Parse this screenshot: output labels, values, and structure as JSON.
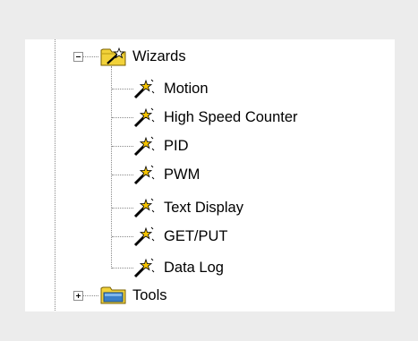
{
  "tree": {
    "wizards": {
      "label": "Wizards",
      "icon": "wizard-folder-icon",
      "expanded": true,
      "children": [
        {
          "label": "Motion",
          "icon": "magic-wand-icon"
        },
        {
          "label": "High Speed Counter",
          "icon": "magic-wand-icon"
        },
        {
          "label": "PID",
          "icon": "magic-wand-icon"
        },
        {
          "label": "PWM",
          "icon": "magic-wand-icon"
        },
        {
          "label": "Text Display",
          "icon": "magic-wand-icon"
        },
        {
          "label": "GET/PUT",
          "icon": "magic-wand-icon"
        },
        {
          "label": "Data Log",
          "icon": "magic-wand-icon"
        }
      ]
    },
    "tools": {
      "label": "Tools",
      "icon": "folder-icon",
      "expanded": false
    }
  },
  "colors": {
    "background": "#ececec",
    "panel": "#ffffff",
    "folder_yellow": "#f2d23a",
    "tools_folder_blue": "#3a7fc8",
    "wand_yellow": "#f5c400"
  }
}
